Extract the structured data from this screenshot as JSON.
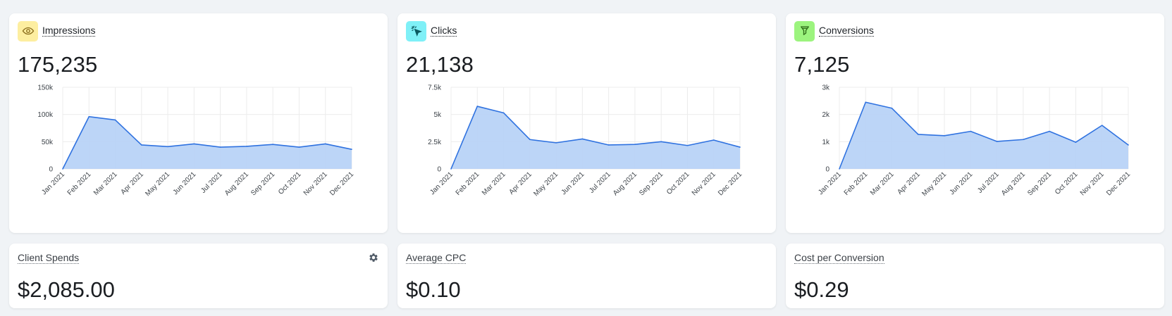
{
  "colors": {
    "area_fill": "#b8d3f7",
    "line": "#2f72e0",
    "grid": "#ececec",
    "impressions_icon_bg": "#fdeea0",
    "clicks_icon_bg": "#7ff0f7",
    "conversions_icon_bg": "#9cf47e"
  },
  "cards": {
    "impressions": {
      "title": "Impressions",
      "value": "175,235",
      "icon": "eye-icon"
    },
    "clicks": {
      "title": "Clicks",
      "value": "21,138",
      "icon": "cursor-click-icon"
    },
    "conversions": {
      "title": "Conversions",
      "value": "7,125",
      "icon": "funnel-icon"
    },
    "client_spends": {
      "title": "Client Spends",
      "value": "$2,085.00",
      "icon": "gear-icon"
    },
    "average_cpc": {
      "title": "Average CPC",
      "value": "$0.10"
    },
    "cost_per_conversion": {
      "title": "Cost per Conversion",
      "value": "$0.29"
    }
  },
  "chart_data": [
    {
      "type": "area",
      "series": [
        {
          "values": [
            0,
            96000,
            90000,
            44000,
            41000,
            46000,
            40000,
            41500,
            45000,
            40000,
            46000,
            36000
          ]
        }
      ],
      "categories": [
        "Jan 2021",
        "Feb 2021",
        "Mar 2021",
        "Apr 2021",
        "May 2021",
        "Jun 2021",
        "Jul 2021",
        "Aug 2021",
        "Sep 2021",
        "Oct 2021",
        "Nov 2021",
        "Dec 2021"
      ],
      "yticks": [
        "0",
        "50k",
        "100k",
        "150k"
      ],
      "ylim": [
        0,
        150000
      ],
      "grid": true
    },
    {
      "type": "area",
      "series": [
        {
          "values": [
            0,
            5750,
            5150,
            2700,
            2400,
            2750,
            2200,
            2250,
            2500,
            2150,
            2650,
            2000
          ]
        }
      ],
      "categories": [
        "Jan 2021",
        "Feb 2021",
        "Mar 2021",
        "Apr 2021",
        "May 2021",
        "Jun 2021",
        "Jul 2021",
        "Aug 2021",
        "Sep 2021",
        "Oct 2021",
        "Nov 2021",
        "Dec 2021"
      ],
      "yticks": [
        "0",
        "2.5k",
        "5k",
        "7.5k"
      ],
      "ylim": [
        0,
        7500
      ],
      "grid": true
    },
    {
      "type": "area",
      "series": [
        {
          "values": [
            0,
            2450,
            2230,
            1270,
            1220,
            1380,
            1010,
            1080,
            1380,
            980,
            1600,
            880
          ]
        }
      ],
      "categories": [
        "Jan 2021",
        "Feb 2021",
        "Mar 2021",
        "Apr 2021",
        "May 2021",
        "Jun 2021",
        "Jul 2021",
        "Aug 2021",
        "Sep 2021",
        "Oct 2021",
        "Nov 2021",
        "Dec 2021"
      ],
      "yticks": [
        "0",
        "1k",
        "2k",
        "3k"
      ],
      "ylim": [
        0,
        3000
      ],
      "grid": true
    }
  ]
}
